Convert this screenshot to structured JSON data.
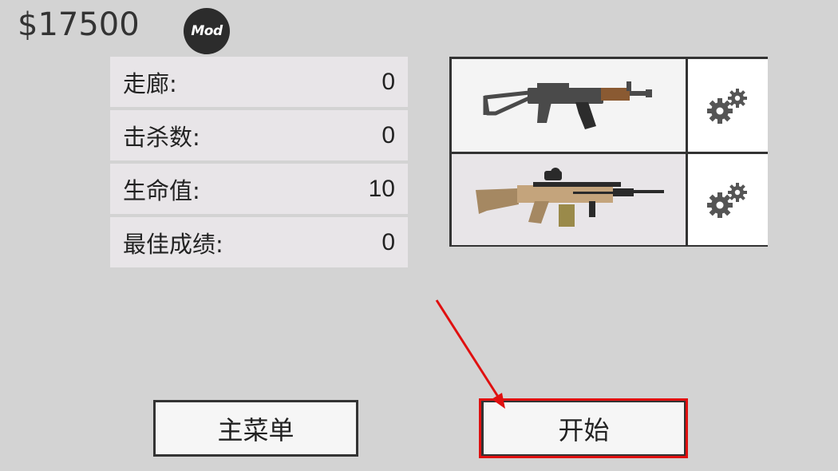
{
  "hud": {
    "money": "$17500",
    "mod_badge": "Mod"
  },
  "stats": [
    {
      "label": "走廊:",
      "value": "0"
    },
    {
      "label": "击杀数:",
      "value": "0"
    },
    {
      "label": "生命值:",
      "value": "10"
    },
    {
      "label": "最佳成绩:",
      "value": "0"
    }
  ],
  "weapons": {
    "primary_icon": "ak-rifle-icon",
    "secondary_icon": "scar-rifle-icon",
    "settings_icon": "gears-icon"
  },
  "buttons": {
    "main_menu": "主菜单",
    "start": "开始"
  },
  "colors": {
    "background": "#d3d3d3",
    "stat_row": "#e8e5e8",
    "annotation_red": "#e01010",
    "border": "#333333"
  }
}
